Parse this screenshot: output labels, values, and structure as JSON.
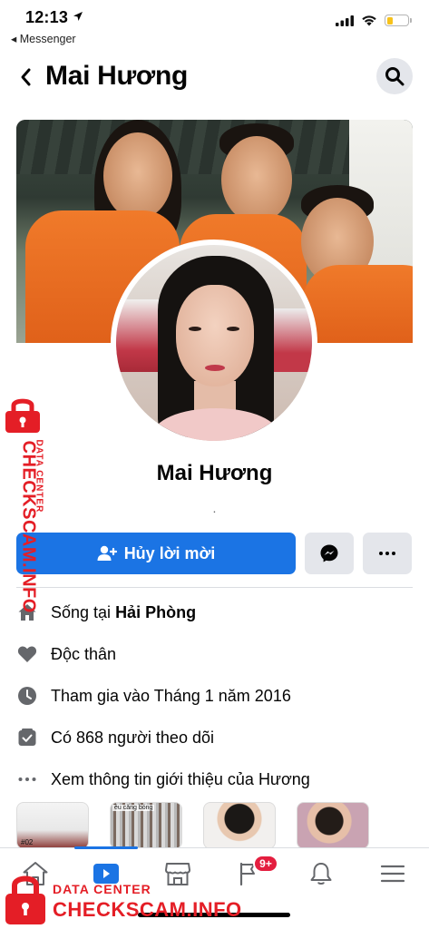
{
  "status_bar": {
    "time": "12:13",
    "back_app": "◂ Messenger",
    "battery_level": 0.28
  },
  "header": {
    "title": "Mai Hương"
  },
  "profile": {
    "name": "Mai Hương",
    "bio": "."
  },
  "actions": {
    "cancel_request_label": "Hủy lời mời"
  },
  "info": [
    {
      "icon": "home-icon",
      "prefix": "Sống tại ",
      "bold": "Hải Phòng"
    },
    {
      "icon": "heart-icon",
      "prefix": "Độc thân",
      "bold": ""
    },
    {
      "icon": "clock-icon",
      "prefix": "Tham gia vào Tháng 1 năm 2016",
      "bold": ""
    },
    {
      "icon": "followers-icon",
      "prefix": "Có 868 người theo dõi",
      "bold": ""
    },
    {
      "icon": "more-info-icon",
      "prefix": "Xem thông tin giới thiệu của Hương",
      "bold": ""
    }
  ],
  "photos": {
    "photo1_label": "#02",
    "photo2_label": "ều căng bóng"
  },
  "tabbar": {
    "notifications_badge": "9+"
  },
  "watermark": {
    "sub": "DATA CENTER",
    "title": "CHECKSCAM.INFO"
  },
  "colors": {
    "accent": "#1b74e4",
    "badge": "#e41e3f",
    "watermark": "#e41e26",
    "battery": "#f7c21b"
  }
}
